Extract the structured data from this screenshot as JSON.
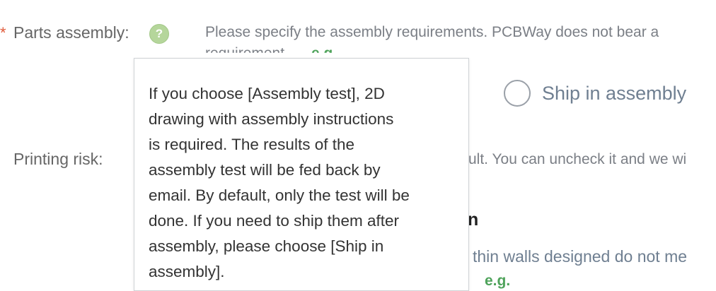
{
  "parts_assembly": {
    "required_mark": "*",
    "label": "Parts assembly:",
    "help_icon_glyph": "?",
    "description_line1": "Please specify the assembly requirements. PCBWay does not bear a",
    "description_line2": "requirement",
    "eg_link": "e.g.",
    "ship_option_label": "Ship in assembly"
  },
  "printing_risk": {
    "label": "Printing risk:",
    "text_partial": "ult. You can uncheck it and we wi"
  },
  "hidden_heading_tail": "n",
  "thin_walls": {
    "text_partial": "thin walls designed do not me",
    "eg_link": "e.g."
  },
  "tooltip": {
    "lines": [
      "If you choose [Assembly test], 2D",
      "drawing with assembly instructions",
      "is required. The results of the",
      "assembly test will be fed back by",
      "email. By default, only the test will be",
      "done. If you need to ship them after",
      "assembly, please choose [Ship in",
      "assembly]."
    ]
  },
  "colors": {
    "required": "#e05a3a",
    "link_green": "#4fa35b",
    "help_icon": "#b5d69b",
    "option_text": "#6f7f91"
  }
}
